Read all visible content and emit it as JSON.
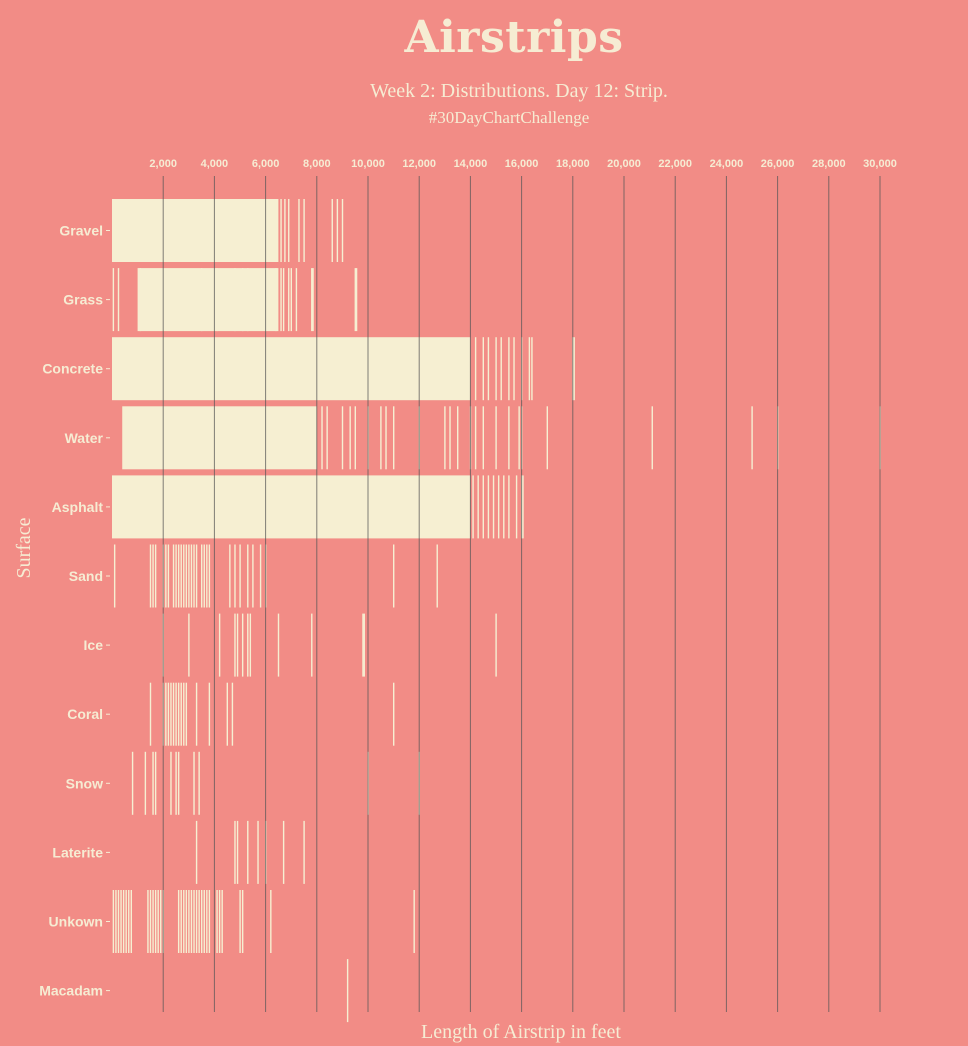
{
  "chart_data": {
    "type": "strip",
    "title": "Airstrips",
    "subtitle": "Week 2: Distributions. Day 12: Strip.",
    "hashtag": "#30DayChartChallenge",
    "xlabel": "Length of Airstrip in feet",
    "ylabel": "Surface",
    "x_ticks": [
      2000,
      4000,
      6000,
      8000,
      10000,
      12000,
      14000,
      16000,
      18000,
      20000,
      22000,
      24000,
      26000,
      28000,
      30000
    ],
    "x_tick_labels": [
      "2,000",
      "4,000",
      "6,000",
      "8,000",
      "10,000",
      "12,000",
      "14,000",
      "16,000",
      "18,000",
      "20,000",
      "22,000",
      "24,000",
      "26,000",
      "28,000",
      "30,000"
    ],
    "grid": true,
    "colors": {
      "background": "#f28c86",
      "strip": "#f6efd2",
      "grid": "#555555",
      "text": "#f6ecd3"
    },
    "categories": [
      "Gravel",
      "Grass",
      "Concrete",
      "Water",
      "Asphalt",
      "Sand",
      "Ice",
      "Coral",
      "Snow",
      "Laterite",
      "Unkown",
      "Macadam"
    ],
    "series": [
      {
        "name": "Gravel",
        "dense_ranges": [
          [
            0,
            6500
          ]
        ],
        "values": [
          100,
          300,
          600,
          900,
          6600,
          6750,
          6900,
          7300,
          7500,
          8600,
          8800,
          9000
        ]
      },
      {
        "name": "Grass",
        "dense_ranges": [
          [
            1000,
            6500
          ]
        ],
        "values": [
          50,
          250,
          1100,
          3500,
          4100,
          4800,
          5100,
          5300,
          6000,
          6400,
          6600,
          6700,
          6900,
          7000,
          7200,
          7800,
          7850,
          9500,
          9550
        ]
      },
      {
        "name": "Concrete",
        "dense_ranges": [
          [
            0,
            14000
          ]
        ],
        "values": [
          14200,
          14500,
          14700,
          15000,
          15200,
          15500,
          15700,
          16000,
          16300,
          16400,
          18000,
          18050
        ]
      },
      {
        "name": "Water",
        "dense_ranges": [
          [
            400,
            8000
          ]
        ],
        "values": [
          8200,
          8400,
          9000,
          9300,
          9500,
          10000,
          10500,
          10700,
          11000,
          12000,
          13000,
          13200,
          13500,
          14000,
          14200,
          14500,
          15000,
          15500,
          15900,
          16000,
          17000,
          21100,
          25000,
          26000,
          30000
        ]
      },
      {
        "name": "Asphalt",
        "dense_ranges": [
          [
            0,
            14000
          ]
        ],
        "values": [
          14100,
          14300,
          14500,
          14700,
          14900,
          15100,
          15300,
          15500,
          15800,
          16000,
          16050
        ]
      },
      {
        "name": "Sand",
        "values": [
          100,
          1500,
          1600,
          1700,
          2000,
          2100,
          2200,
          2400,
          2500,
          2600,
          2700,
          2800,
          2900,
          3000,
          3100,
          3200,
          3300,
          3500,
          3600,
          3700,
          3800,
          4600,
          4800,
          5000,
          5300,
          5500,
          5800,
          6000,
          11000,
          12700
        ]
      },
      {
        "name": "Ice",
        "values": [
          2000,
          3000,
          4200,
          4800,
          4900,
          5100,
          5300,
          5400,
          6500,
          7800,
          9800,
          9850,
          15000
        ]
      },
      {
        "name": "Coral",
        "values": [
          1500,
          2000,
          2100,
          2200,
          2300,
          2400,
          2500,
          2600,
          2700,
          2800,
          2900,
          3300,
          3800,
          4500,
          4700,
          11000
        ]
      },
      {
        "name": "Snow",
        "values": [
          800,
          1300,
          1600,
          1700,
          2300,
          2500,
          2600,
          3200,
          3400,
          10000,
          12000
        ]
      },
      {
        "name": "Laterite",
        "values": [
          3300,
          4800,
          4900,
          5300,
          5700,
          6000,
          6700,
          7500
        ]
      },
      {
        "name": "Unkown",
        "values": [
          50,
          150,
          250,
          350,
          450,
          550,
          650,
          750,
          1400,
          1500,
          1600,
          1700,
          1800,
          1900,
          2000,
          2600,
          2700,
          2800,
          2900,
          3000,
          3100,
          3200,
          3300,
          3400,
          3500,
          3600,
          3700,
          3800,
          4100,
          4200,
          4300,
          5000,
          5100,
          6200,
          11800
        ]
      },
      {
        "name": "Macadam",
        "values": [
          9200
        ]
      }
    ]
  }
}
